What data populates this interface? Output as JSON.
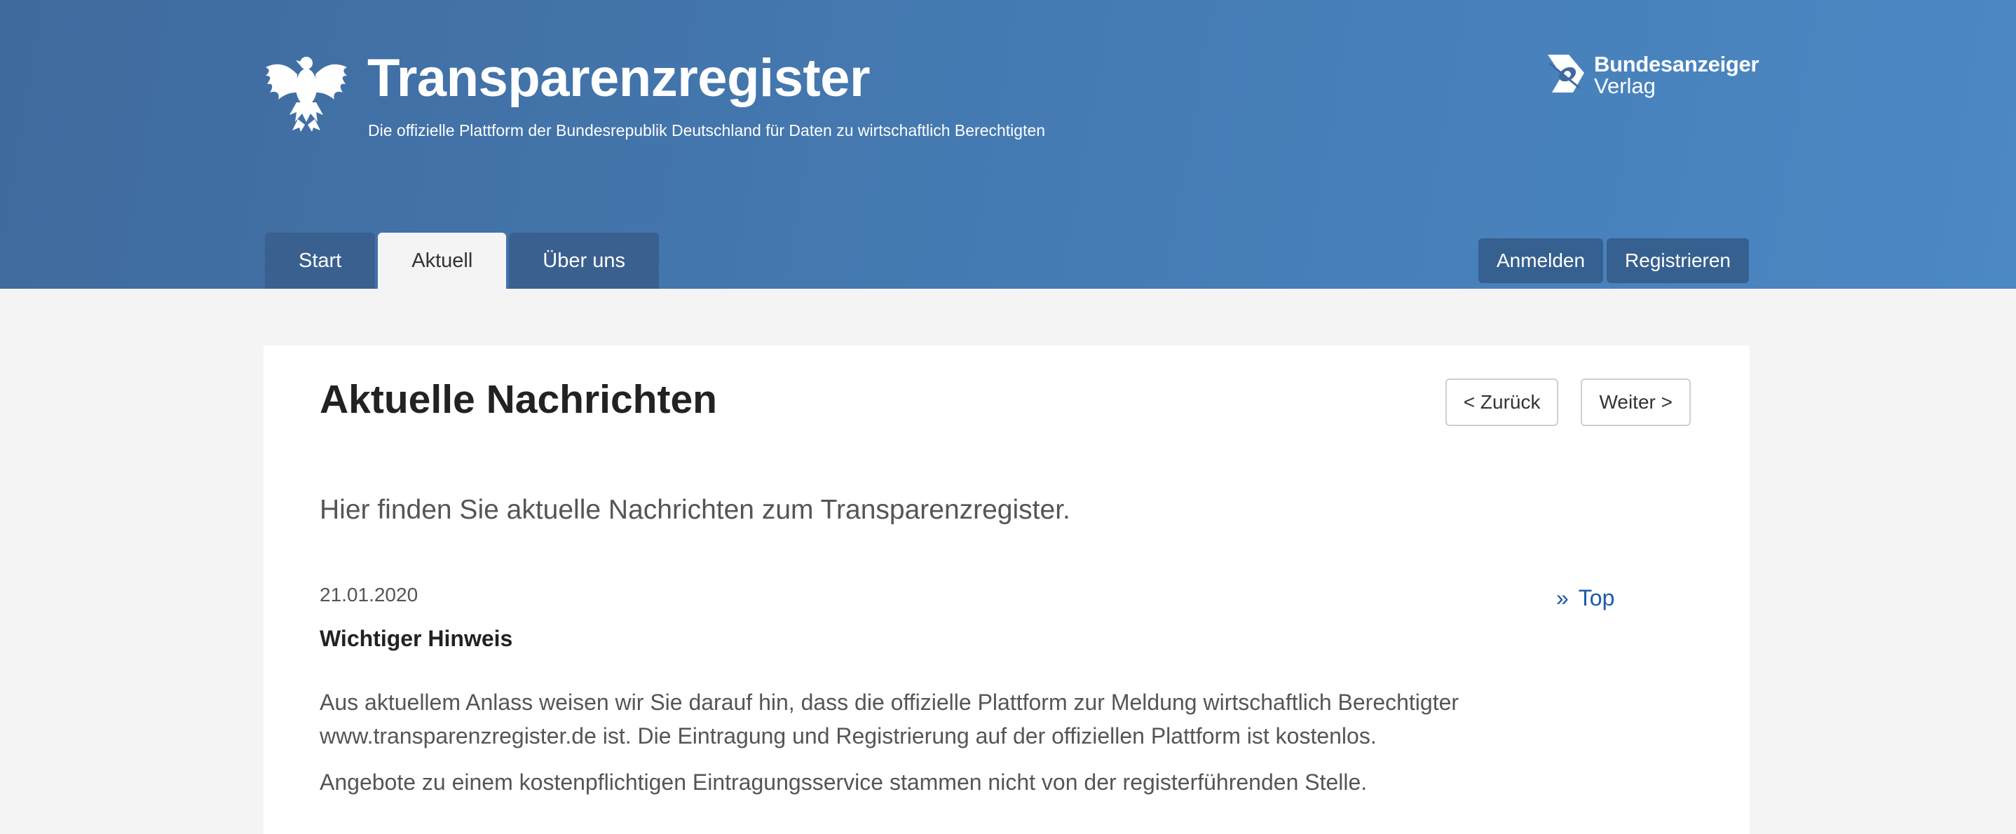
{
  "header": {
    "title": "Transparenzregister",
    "subtitle": "Die offizielle Plattform der Bundesrepublik Deutschland für Daten zu wirtschaftlich Berechtigten",
    "logo_icon": "federal-eagle-icon",
    "publisher": {
      "line1": "Bundesanzeiger",
      "line2": "Verlag",
      "icon": "bundesanzeiger-logo-icon"
    }
  },
  "nav": {
    "tabs": [
      {
        "label": "Start",
        "active": false
      },
      {
        "label": "Aktuell",
        "active": true
      },
      {
        "label": "Über uns",
        "active": false
      }
    ],
    "login_label": "Anmelden",
    "register_label": "Registrieren"
  },
  "main": {
    "title": "Aktuelle Nachrichten",
    "back_label": "< Zurück",
    "next_label": "Weiter >",
    "intro": "Hier finden Sie aktuelle Nachrichten zum Transparenzregister.",
    "top_link": "Top",
    "top_link_prefix": "»",
    "news": {
      "date": "21.01.2020",
      "title": "Wichtiger Hinweis",
      "paragraphs": [
        "Aus aktuellem Anlass weisen wir Sie darauf hin, dass die offizielle Plattform zur Meldung wirtschaftlich Berechtigter www.transparenzregister.de ist. Die Eintragung und Registrierung auf der offiziellen Plattform ist kostenlos.",
        "Angebote zu einem kostenpflichtigen Eintragungsservice stammen nicht von der registerführenden Stelle."
      ]
    }
  },
  "colors": {
    "header_start": "#3f6a9e",
    "header_end": "#4b88c4",
    "button": "#36608f",
    "link": "#1a5aa8"
  }
}
